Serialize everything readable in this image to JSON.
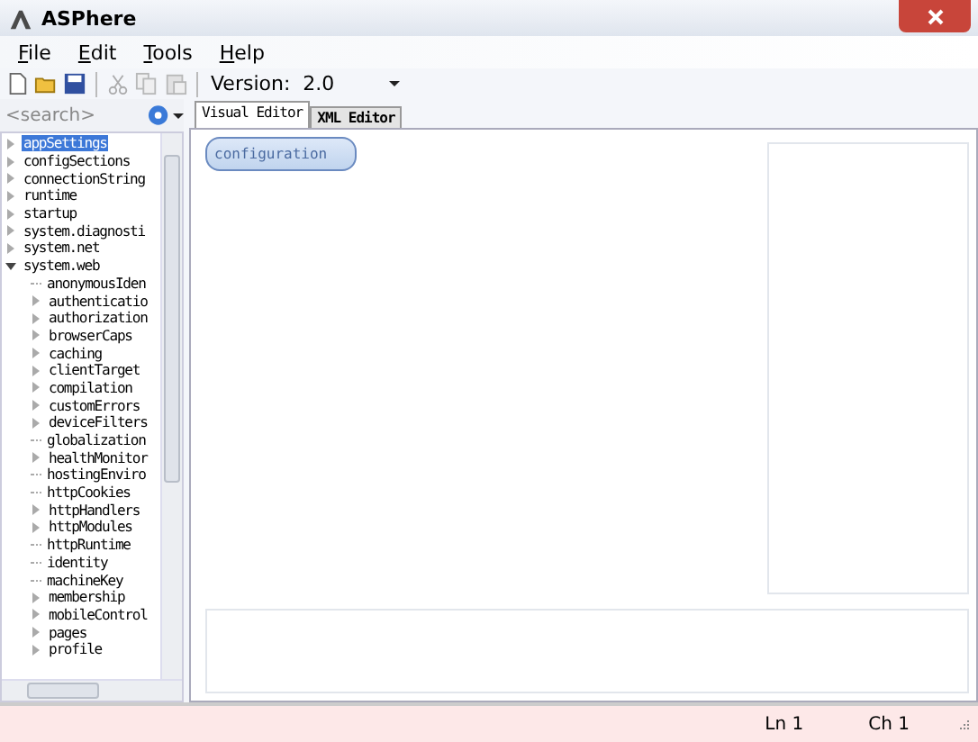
{
  "window": {
    "title": "ASPhere"
  },
  "menu": [
    "File",
    "Edit",
    "Tools",
    "Help"
  ],
  "toolbar": {
    "version_label": "Version:",
    "version_value": "2.0"
  },
  "search": {
    "placeholder": "<search>"
  },
  "tree": [
    {
      "label": "appSettings",
      "expandable": true,
      "expanded": false,
      "selected": true
    },
    {
      "label": "configSections",
      "expandable": true,
      "expanded": false,
      "selected": false
    },
    {
      "label": "connectionString",
      "expandable": true,
      "expanded": false,
      "selected": false
    },
    {
      "label": "runtime",
      "expandable": true,
      "expanded": false,
      "selected": false
    },
    {
      "label": "startup",
      "expandable": true,
      "expanded": false,
      "selected": false
    },
    {
      "label": "system.diagnosti",
      "expandable": true,
      "expanded": false,
      "selected": false
    },
    {
      "label": "system.net",
      "expandable": true,
      "expanded": false,
      "selected": false
    },
    {
      "label": "system.web",
      "expandable": true,
      "expanded": true,
      "selected": false,
      "children": [
        {
          "label": "anonymousIden",
          "expandable": false,
          "selected": false
        },
        {
          "label": "authenticatio",
          "expandable": true,
          "selected": false
        },
        {
          "label": "authorization",
          "expandable": true,
          "selected": false
        },
        {
          "label": "browserCaps",
          "expandable": true,
          "selected": false
        },
        {
          "label": "caching",
          "expandable": true,
          "selected": false
        },
        {
          "label": "clientTarget",
          "expandable": true,
          "selected": false
        },
        {
          "label": "compilation",
          "expandable": true,
          "selected": false
        },
        {
          "label": "customErrors",
          "expandable": true,
          "selected": false
        },
        {
          "label": "deviceFilters",
          "expandable": true,
          "selected": false
        },
        {
          "label": "globalization",
          "expandable": false,
          "selected": false
        },
        {
          "label": "healthMonitor",
          "expandable": true,
          "selected": false
        },
        {
          "label": "hostingEnviro",
          "expandable": false,
          "selected": false
        },
        {
          "label": "httpCookies",
          "expandable": false,
          "selected": false
        },
        {
          "label": "httpHandlers",
          "expandable": true,
          "selected": false
        },
        {
          "label": "httpModules",
          "expandable": true,
          "selected": false
        },
        {
          "label": "httpRuntime",
          "expandable": false,
          "selected": false
        },
        {
          "label": "identity",
          "expandable": false,
          "selected": false
        },
        {
          "label": "machineKey",
          "expandable": false,
          "selected": false
        },
        {
          "label": "membership",
          "expandable": true,
          "selected": false
        },
        {
          "label": "mobileControl",
          "expandable": true,
          "selected": false
        },
        {
          "label": "pages",
          "expandable": true,
          "selected": false
        },
        {
          "label": "profile",
          "expandable": true,
          "selected": false
        }
      ]
    }
  ],
  "tabs": [
    {
      "label": "Visual Editor",
      "selected": true
    },
    {
      "label": "XML Editor",
      "selected": false
    }
  ],
  "canvas": {
    "nodes": [
      "configuration"
    ]
  },
  "status_bar": {
    "line": "Ln 1",
    "column": "Ch 1"
  }
}
